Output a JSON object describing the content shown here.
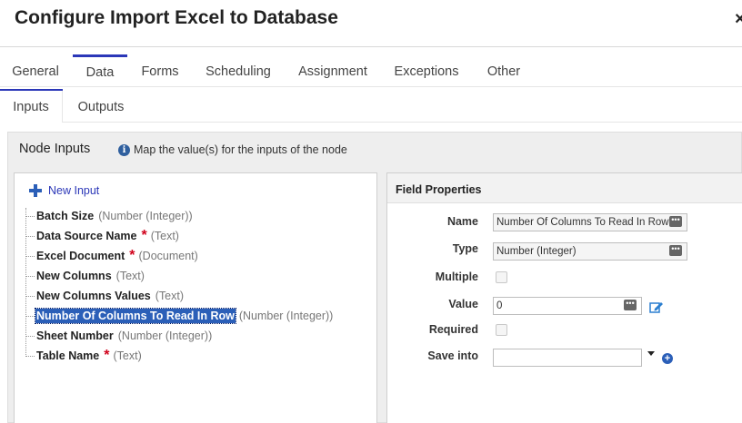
{
  "window": {
    "title": "Configure Import Excel to Database",
    "close_glyph": "×"
  },
  "tabs": [
    {
      "label": "General",
      "state": "selected"
    },
    {
      "label": "Data",
      "state": "highlighted"
    },
    {
      "label": "Forms"
    },
    {
      "label": "Scheduling"
    },
    {
      "label": "Assignment"
    },
    {
      "label": "Exceptions"
    },
    {
      "label": "Other"
    }
  ],
  "subtabs": [
    {
      "label": "Inputs",
      "state": "selected"
    },
    {
      "label": "Outputs"
    }
  ],
  "node_inputs": {
    "title": "Node Inputs",
    "info_glyph": "i",
    "info_text": "Map the value(s) for the inputs of the node",
    "new_input_label": "New Input",
    "items": [
      {
        "name": "Batch Size",
        "required": "",
        "type": "(Number (Integer))"
      },
      {
        "name": "Data Source Name",
        "required": "*",
        "type": "(Text)"
      },
      {
        "name": "Excel Document",
        "required": "*",
        "type": "(Document)"
      },
      {
        "name": "New Columns",
        "required": "",
        "type": "(Text)"
      },
      {
        "name": "New Columns Values",
        "required": "",
        "type": "(Text)"
      },
      {
        "name": "Number Of Columns To Read In Row",
        "required": "",
        "type": "(Number (Integer))",
        "selected": true
      },
      {
        "name": "Sheet Number",
        "required": "",
        "type": "(Number (Integer))"
      },
      {
        "name": "Table Name",
        "required": "*",
        "type": "(Text)"
      }
    ]
  },
  "field_properties": {
    "title": "Field Properties",
    "name_label": "Name",
    "name_value": "Number Of Columns To Read In Row",
    "type_label": "Type",
    "type_value": "Number (Integer)",
    "multiple_label": "Multiple",
    "multiple_checked": false,
    "value_label": "Value",
    "value_value": "0",
    "required_label": "Required",
    "required_checked": false,
    "save_into_label": "Save into",
    "save_into_value": "",
    "dots_glyph": "•••",
    "add_glyph": "+"
  },
  "colors": {
    "accent": "#2b37b8",
    "selected_bg": "#2b5fb8",
    "required": "#d0021b"
  }
}
